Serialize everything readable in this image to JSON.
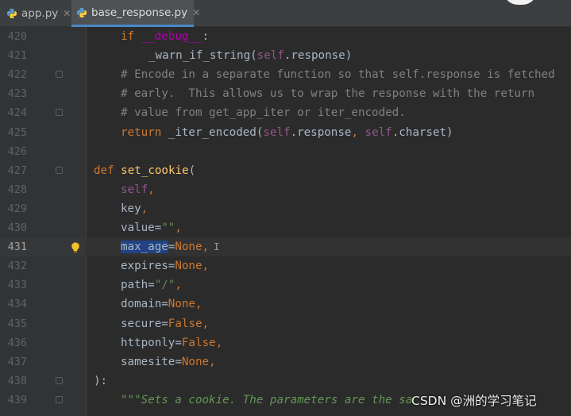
{
  "tabs": [
    {
      "label": "app.py",
      "active": false
    },
    {
      "label": "base_response.py",
      "active": true
    }
  ],
  "editor": {
    "current_line": "431",
    "lines": [
      {
        "num": "420",
        "tokens": [
          {
            "t": "if ",
            "c": "kw"
          },
          {
            "t": "__debug__",
            "c": "dunder"
          },
          {
            "t": ":",
            "c": ""
          }
        ]
      },
      {
        "num": "421",
        "tokens": [
          {
            "t": "_warn_if_string(",
            "c": ""
          },
          {
            "t": "self",
            "c": "self"
          },
          {
            "t": ".response)",
            "c": ""
          }
        ]
      },
      {
        "num": "422",
        "tokens": [
          {
            "t": "# Encode in a separate function so that self.response is fetched",
            "c": "cm"
          }
        ]
      },
      {
        "num": "423",
        "tokens": [
          {
            "t": "# early.  This allows us to wrap the response with the return",
            "c": "cm"
          }
        ]
      },
      {
        "num": "424",
        "tokens": [
          {
            "t": "# value from get_app_iter or iter_encoded.",
            "c": "cm"
          }
        ]
      },
      {
        "num": "425",
        "tokens": [
          {
            "t": "return ",
            "c": "kw"
          },
          {
            "t": "_iter_encoded(",
            "c": ""
          },
          {
            "t": "self",
            "c": "self"
          },
          {
            "t": ".response",
            "c": ""
          },
          {
            "t": ", ",
            "c": "kw"
          },
          {
            "t": "self",
            "c": "self"
          },
          {
            "t": ".charset)",
            "c": ""
          }
        ]
      },
      {
        "num": "426",
        "tokens": []
      },
      {
        "num": "427",
        "tokens": [
          {
            "t": "def ",
            "c": "kw"
          },
          {
            "t": "set_cookie",
            "c": "fn"
          },
          {
            "t": "(",
            "c": ""
          }
        ]
      },
      {
        "num": "428",
        "tokens": [
          {
            "t": "self",
            "c": "self"
          },
          {
            "t": ",",
            "c": "kw"
          }
        ]
      },
      {
        "num": "429",
        "tokens": [
          {
            "t": "key",
            "c": ""
          },
          {
            "t": ",",
            "c": "kw"
          }
        ]
      },
      {
        "num": "430",
        "tokens": [
          {
            "t": "value=",
            "c": ""
          },
          {
            "t": "\"\"",
            "c": "str"
          },
          {
            "t": ",",
            "c": "kw"
          }
        ]
      },
      {
        "num": "431",
        "tokens": [
          {
            "t": "max_age",
            "c": "sel"
          },
          {
            "t": "=",
            "c": ""
          },
          {
            "t": "None",
            "c": "kw"
          },
          {
            "t": ",",
            "c": "kw"
          }
        ]
      },
      {
        "num": "432",
        "tokens": [
          {
            "t": "expires=",
            "c": ""
          },
          {
            "t": "None",
            "c": "kw"
          },
          {
            "t": ",",
            "c": "kw"
          }
        ]
      },
      {
        "num": "433",
        "tokens": [
          {
            "t": "path=",
            "c": ""
          },
          {
            "t": "\"/\"",
            "c": "str"
          },
          {
            "t": ",",
            "c": "kw"
          }
        ]
      },
      {
        "num": "434",
        "tokens": [
          {
            "t": "domain=",
            "c": ""
          },
          {
            "t": "None",
            "c": "kw"
          },
          {
            "t": ",",
            "c": "kw"
          }
        ]
      },
      {
        "num": "435",
        "tokens": [
          {
            "t": "secure=",
            "c": ""
          },
          {
            "t": "False",
            "c": "kw"
          },
          {
            "t": ",",
            "c": "kw"
          }
        ]
      },
      {
        "num": "436",
        "tokens": [
          {
            "t": "httponly=",
            "c": ""
          },
          {
            "t": "False",
            "c": "kw"
          },
          {
            "t": ",",
            "c": "kw"
          }
        ]
      },
      {
        "num": "437",
        "tokens": [
          {
            "t": "samesite=",
            "c": ""
          },
          {
            "t": "None",
            "c": "kw"
          },
          {
            "t": ",",
            "c": "kw"
          }
        ]
      },
      {
        "num": "438",
        "tokens": [
          {
            "t": "):",
            "c": ""
          }
        ]
      },
      {
        "num": "439",
        "tokens": [
          {
            "t": "\"\"\"Sets a cookie. The parameters are the sa",
            "c": "doc"
          }
        ]
      }
    ]
  },
  "watermark": "CSDN @洲的学习笔记",
  "colors": {
    "background": "#2b2b2b",
    "keyword": "#cc7832",
    "function": "#ffc66d",
    "self": "#94558d",
    "string": "#6a8759",
    "comment": "#808080",
    "selection": "#214283"
  },
  "icons": [
    "python-file-icon",
    "close-icon",
    "lightbulb-icon",
    "fold-marker-icon",
    "text-cursor-icon"
  ]
}
